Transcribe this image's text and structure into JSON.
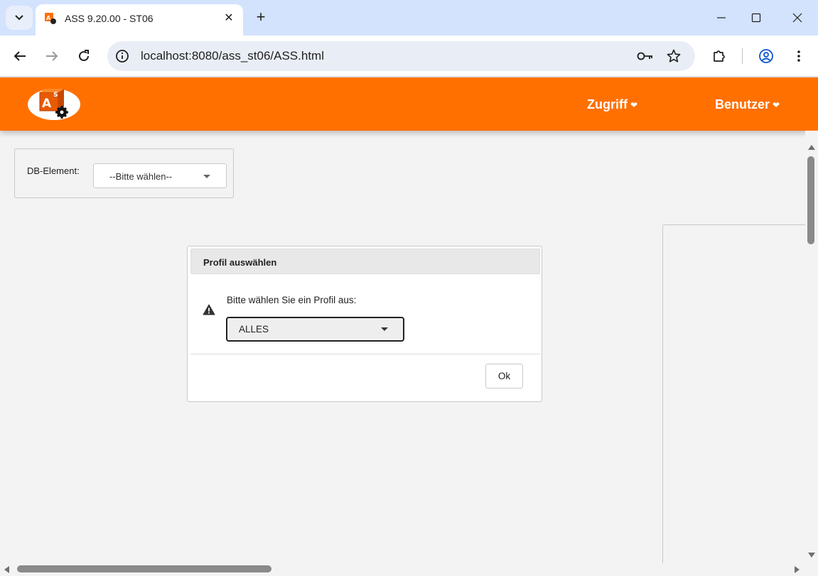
{
  "browser": {
    "tab_title": "ASS 9.20.00 - ST06",
    "tab_close": "✕",
    "new_tab": "+",
    "url": "localhost:8080/ass_st06/ASS.html"
  },
  "app": {
    "accent_color": "#ff7000",
    "logo_icon": "ass-logo-icon",
    "menu": [
      {
        "label": "Zugriff",
        "chevron": "❤"
      },
      {
        "label": "Benutzer",
        "chevron": "❤"
      }
    ]
  },
  "db_element": {
    "label": "DB-Element:",
    "selected": "--Bitte wählen--"
  },
  "dialog": {
    "title": "Profil auswählen",
    "icon": "warning-icon",
    "message": "Bitte wählen Sie ein Profil aus:",
    "selected_profile": "ALLES",
    "ok_label": "Ok"
  }
}
